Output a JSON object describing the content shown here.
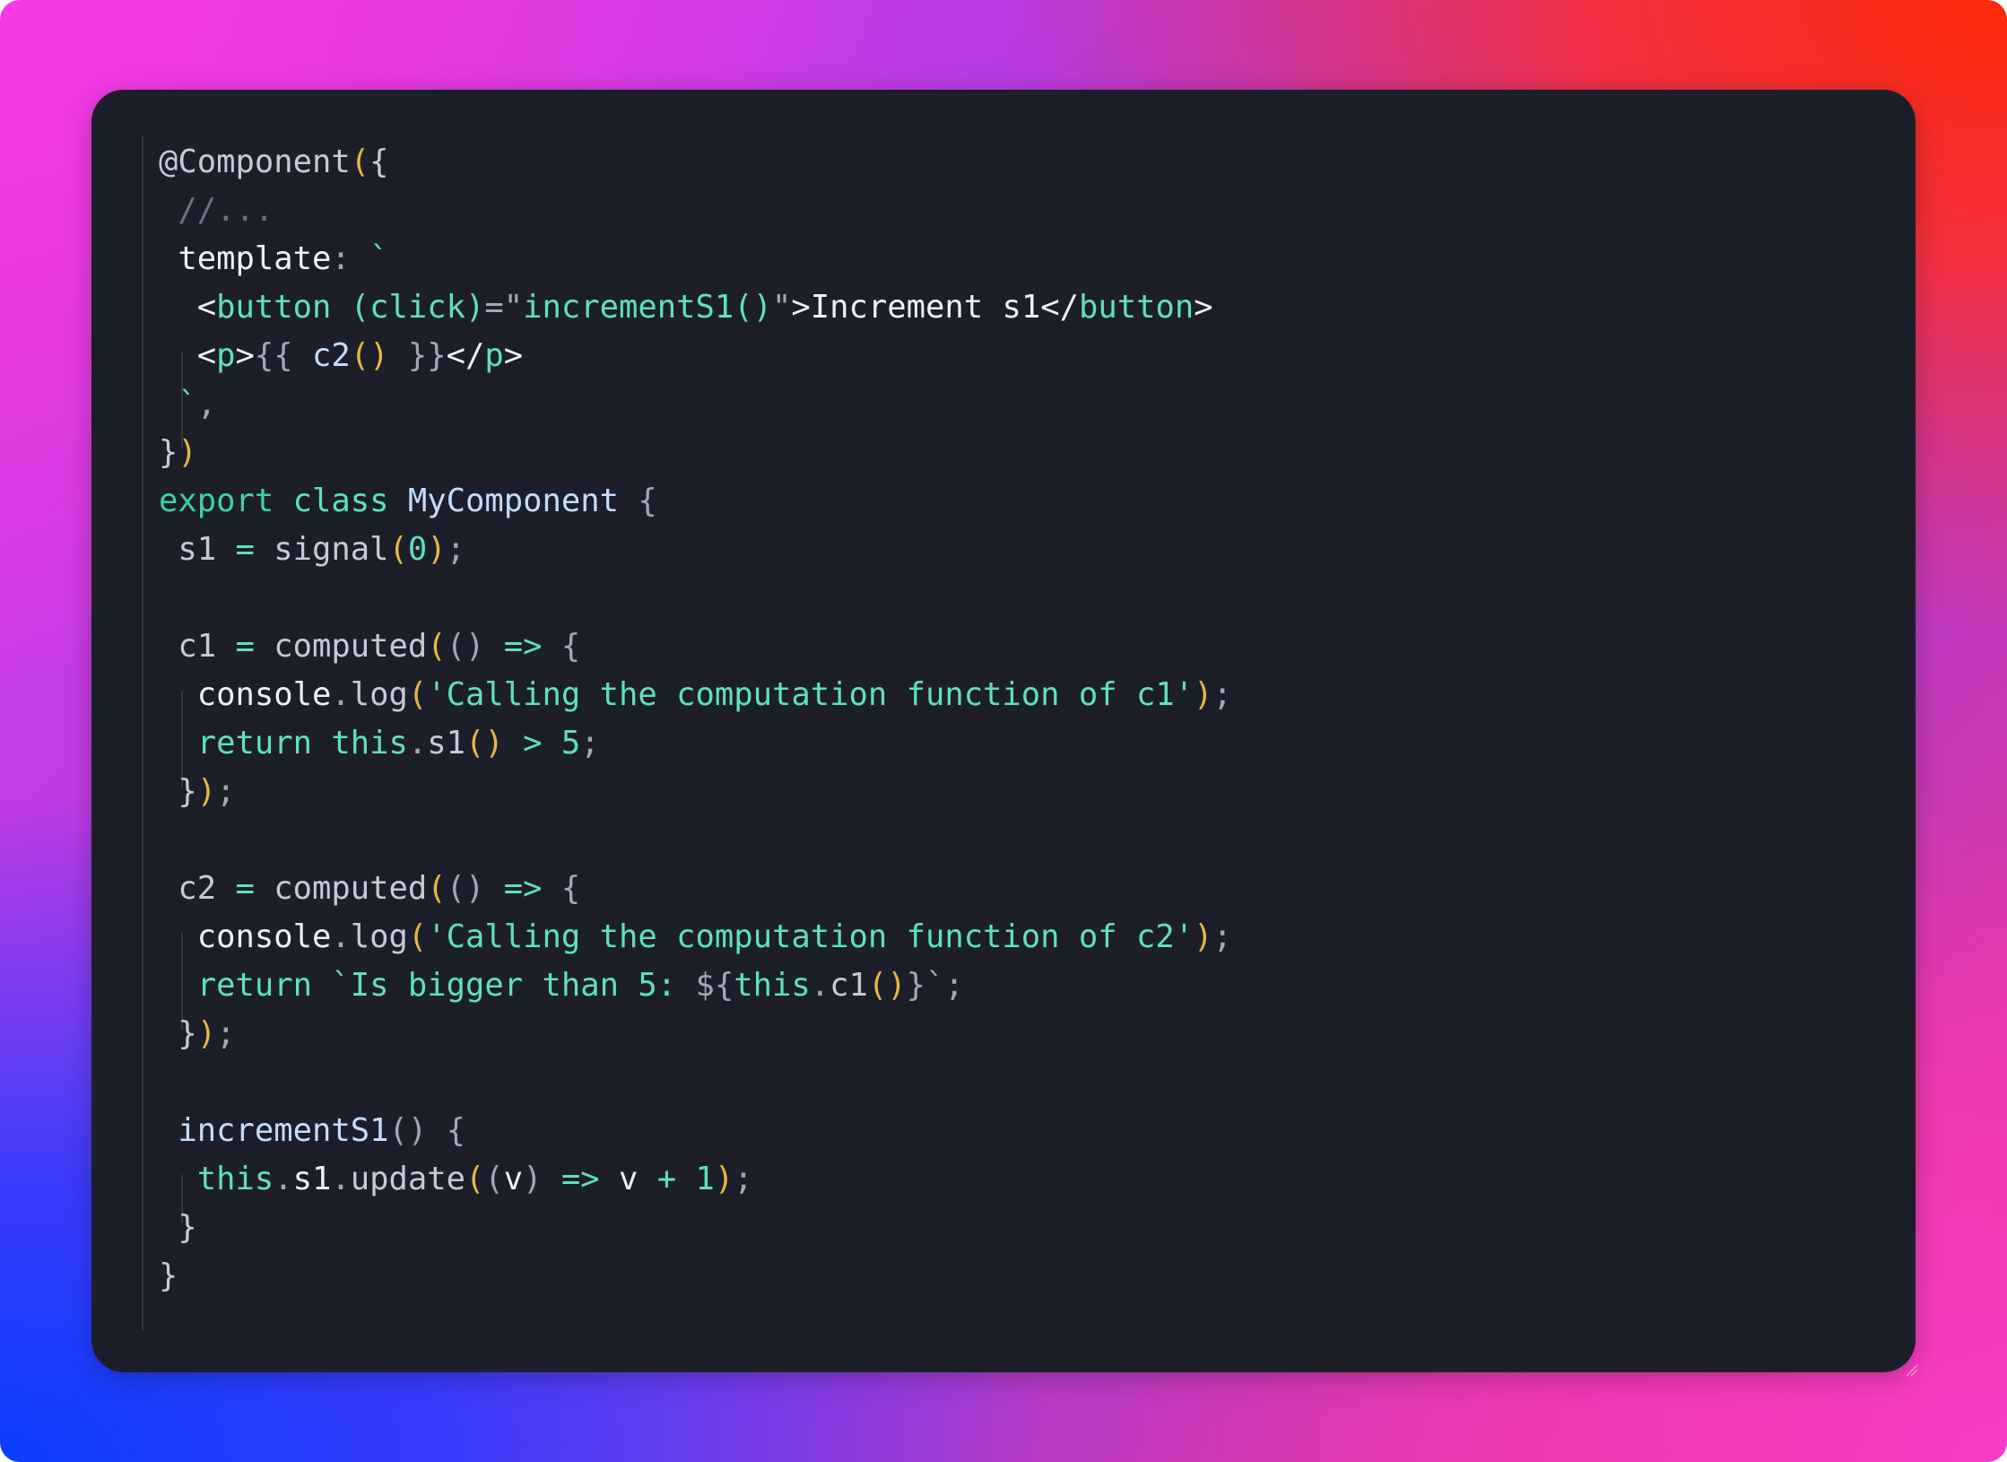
{
  "window": {
    "language": "typescript",
    "background_colors": {
      "top_left": "#f73ae4",
      "top_right": "#ff2a08",
      "bottom_left": "#0a3dff",
      "bottom_right": "#f83cc8",
      "editor": "#1c1f29"
    }
  },
  "theme": {
    "plain": "#c7c9d9",
    "bright": "#eef0f6",
    "teal": "#5ee0c0",
    "keyword_green": "#3fd0a3",
    "identifier_blue": "#c3dcff",
    "bracket_yellow": "#e8b83e",
    "comment": "#6c7086"
  },
  "code": {
    "lines": [
      {
        "indent": 0,
        "tokens": [
          [
            "plain",
            "@Component"
          ],
          [
            "yellow",
            "("
          ],
          [
            "plain",
            "{"
          ]
        ]
      },
      {
        "indent": 1,
        "tokens": [
          [
            "comment",
            "//..."
          ]
        ]
      },
      {
        "indent": 1,
        "tokens": [
          [
            "bright",
            "template"
          ],
          [
            "punct",
            ": "
          ],
          [
            "teal",
            "`"
          ]
        ]
      },
      {
        "indent": 2,
        "tokens": [
          [
            "bright",
            "<"
          ],
          [
            "teal",
            "button "
          ],
          [
            "teal",
            "(click)"
          ],
          [
            "punct",
            "=\""
          ],
          [
            "teal",
            "incrementS1()"
          ],
          [
            "punct",
            "\""
          ],
          [
            "bright",
            ">Increment s1</"
          ],
          [
            "teal",
            "button"
          ],
          [
            "bright",
            ">"
          ]
        ]
      },
      {
        "indent": 2,
        "tokens": [
          [
            "bright",
            "<"
          ],
          [
            "teal",
            "p"
          ],
          [
            "bright",
            ">"
          ],
          [
            "punct",
            "{{ "
          ],
          [
            "blue",
            "c2"
          ],
          [
            "yellow",
            "()"
          ],
          [
            "punct",
            " }}"
          ],
          [
            "bright",
            "</"
          ],
          [
            "teal",
            "p"
          ],
          [
            "bright",
            ">"
          ]
        ]
      },
      {
        "indent": 1,
        "tokens": [
          [
            "teal",
            "`"
          ],
          [
            "punct",
            ","
          ]
        ]
      },
      {
        "indent": 0,
        "tokens": [
          [
            "plain",
            "}"
          ],
          [
            "yellow",
            ")"
          ]
        ]
      },
      {
        "indent": 0,
        "tokens": [
          [
            "green",
            "export "
          ],
          [
            "teal",
            "class "
          ],
          [
            "blue",
            "MyComponent "
          ],
          [
            "punct",
            "{"
          ]
        ]
      },
      {
        "indent": 1,
        "tokens": [
          [
            "plain",
            "s1 "
          ],
          [
            "teal",
            "= "
          ],
          [
            "plain",
            "signal"
          ],
          [
            "yellow",
            "("
          ],
          [
            "num",
            "0"
          ],
          [
            "yellow",
            ")"
          ],
          [
            "punct",
            ";"
          ]
        ]
      },
      {
        "indent": 0,
        "tokens": []
      },
      {
        "indent": 1,
        "tokens": [
          [
            "plain",
            "c1 "
          ],
          [
            "teal",
            "= "
          ],
          [
            "plain",
            "computed"
          ],
          [
            "yellow",
            "("
          ],
          [
            "punct",
            "() "
          ],
          [
            "teal",
            "=> "
          ],
          [
            "punct",
            "{"
          ]
        ]
      },
      {
        "indent": 2,
        "tokens": [
          [
            "bright",
            "console"
          ],
          [
            "punct",
            "."
          ],
          [
            "plain",
            "log"
          ],
          [
            "yellow",
            "("
          ],
          [
            "teal",
            "'Calling the computation function of c1'"
          ],
          [
            "yellow",
            ")"
          ],
          [
            "punct",
            ";"
          ]
        ]
      },
      {
        "indent": 2,
        "tokens": [
          [
            "teal",
            "return this"
          ],
          [
            "punct",
            "."
          ],
          [
            "plain",
            "s1"
          ],
          [
            "yellow",
            "()"
          ],
          [
            "teal",
            " > 5"
          ],
          [
            "punct",
            ";"
          ]
        ]
      },
      {
        "indent": 1,
        "tokens": [
          [
            "plain",
            "}"
          ],
          [
            "yellow",
            ")"
          ],
          [
            "punct",
            ";"
          ]
        ]
      },
      {
        "indent": 0,
        "tokens": []
      },
      {
        "indent": 1,
        "tokens": [
          [
            "plain",
            "c2 "
          ],
          [
            "teal",
            "= "
          ],
          [
            "plain",
            "computed"
          ],
          [
            "yellow",
            "("
          ],
          [
            "punct",
            "() "
          ],
          [
            "teal",
            "=> "
          ],
          [
            "punct",
            "{"
          ]
        ]
      },
      {
        "indent": 2,
        "tokens": [
          [
            "bright",
            "console"
          ],
          [
            "punct",
            "."
          ],
          [
            "plain",
            "log"
          ],
          [
            "yellow",
            "("
          ],
          [
            "teal",
            "'Calling the computation function of c2'"
          ],
          [
            "yellow",
            ")"
          ],
          [
            "punct",
            ";"
          ]
        ]
      },
      {
        "indent": 2,
        "tokens": [
          [
            "teal",
            "return `Is bigger than 5: "
          ],
          [
            "punct",
            "${"
          ],
          [
            "teal",
            "this"
          ],
          [
            "punct",
            "."
          ],
          [
            "plain",
            "c1"
          ],
          [
            "yellow",
            "()"
          ],
          [
            "punct",
            "}"
          ],
          [
            "punct",
            "`;"
          ]
        ]
      },
      {
        "indent": 1,
        "tokens": [
          [
            "plain",
            "}"
          ],
          [
            "yellow",
            ")"
          ],
          [
            "punct",
            ";"
          ]
        ]
      },
      {
        "indent": 0,
        "tokens": []
      },
      {
        "indent": 1,
        "tokens": [
          [
            "blue",
            "incrementS1"
          ],
          [
            "punct",
            "() {"
          ]
        ]
      },
      {
        "indent": 2,
        "tokens": [
          [
            "teal",
            "this"
          ],
          [
            "punct",
            "."
          ],
          [
            "bright",
            "s1"
          ],
          [
            "punct",
            "."
          ],
          [
            "plain",
            "update"
          ],
          [
            "yellow",
            "("
          ],
          [
            "punct",
            "("
          ],
          [
            "bright",
            "v"
          ],
          [
            "punct",
            ") "
          ],
          [
            "teal",
            "=> "
          ],
          [
            "bright",
            "v "
          ],
          [
            "teal",
            "+ 1"
          ],
          [
            "yellow",
            ")"
          ],
          [
            "punct",
            ";"
          ]
        ]
      },
      {
        "indent": 1,
        "tokens": [
          [
            "plain",
            "}"
          ]
        ]
      },
      {
        "indent": 0,
        "tokens": [
          [
            "plain",
            "}"
          ]
        ]
      }
    ]
  }
}
